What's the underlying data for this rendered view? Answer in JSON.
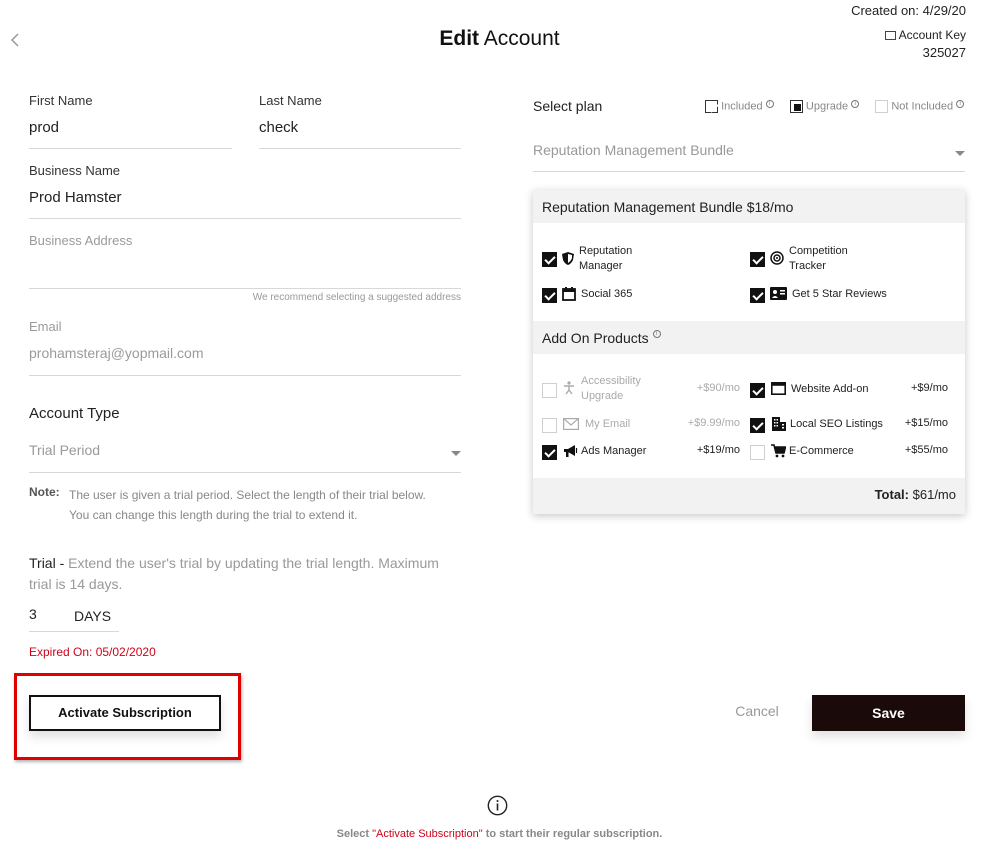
{
  "header": {
    "title_bold": "Edit",
    "title_rest": "Account",
    "created_on": "Created on: 4/29/20",
    "account_key_label": "Account Key",
    "account_key_value": "325027"
  },
  "form": {
    "first_name_label": "First Name",
    "first_name_value": "prod",
    "last_name_label": "Last Name",
    "last_name_value": "check",
    "business_name_label": "Business Name",
    "business_name_value": "Prod Hamster",
    "business_address_label": "Business Address",
    "address_hint": "We recommend selecting a suggested address",
    "email_label": "Email",
    "email_value": "prohamsteraj@yopmail.com",
    "account_type_label": "Account Type",
    "account_type_value": "Trial Period",
    "note_label": "Note:",
    "note_line1": "The user is given a trial period. Select the length of their trial below.",
    "note_line2": "You can change this length during the trial to extend it.",
    "trial_label": "Trial -",
    "trial_desc_line1": "Extend the user's trial by updating the trial length. Maximum",
    "trial_desc_line2": "trial is 14 days.",
    "trial_value": "3",
    "trial_unit": "DAYS",
    "expired": "Expired On: 05/02/2020"
  },
  "plan": {
    "select_label": "Select plan",
    "legend_included": "Included",
    "legend_upgrade": "Upgrade",
    "legend_not_included": "Not Included",
    "dropdown_value": "Reputation Management Bundle",
    "card_title": "Reputation Management Bundle $18/mo",
    "features": [
      {
        "line1": "Reputation",
        "line2": "Manager",
        "icon": "shield-icon"
      },
      {
        "line1": "Competition",
        "line2": "Tracker",
        "icon": "radar-icon"
      },
      {
        "line1": "Social 365",
        "line2": "",
        "icon": "calendar-icon"
      },
      {
        "line1": "Get 5 Star Reviews",
        "line2": "",
        "icon": "id-card-icon"
      }
    ],
    "addons_title": "Add On Products",
    "addons": [
      {
        "line1": "Accessibility",
        "line2": "Upgrade",
        "price": "+$90/mo",
        "checked": false
      },
      {
        "line1": "Website Add-on",
        "line2": "",
        "price": "+$9/mo",
        "checked": true
      },
      {
        "line1": "My Email",
        "line2": "",
        "price": "+$9.99/mo",
        "checked": false
      },
      {
        "line1": "Local SEO Listings",
        "line2": "",
        "price": "+$15/mo",
        "checked": true
      },
      {
        "line1": "Ads Manager",
        "line2": "",
        "price": "+$19/mo",
        "checked": true
      },
      {
        "line1": "E-Commerce",
        "line2": "",
        "price": "+$55/mo",
        "checked": false
      }
    ],
    "total_label": "Total:",
    "total_value": "$61/mo"
  },
  "actions": {
    "activate_label": "Activate Subscription",
    "cancel_label": "Cancel",
    "save_label": "Save"
  },
  "footer": {
    "pre": "Select ",
    "highlight": "\"Activate Subscription\"",
    "post": " to start their regular subscription."
  },
  "colors": {
    "accent_red": "#d0021b",
    "dark": "#1a0a0a",
    "highlight_box": "#e00000"
  }
}
